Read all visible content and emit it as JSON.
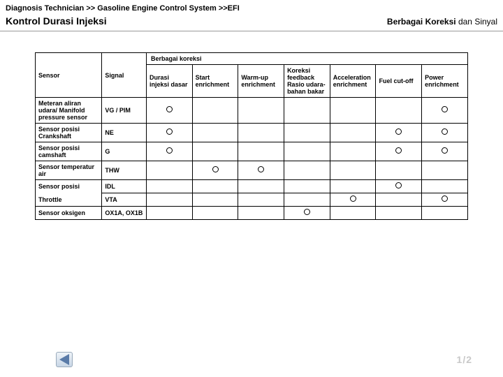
{
  "breadcrumb": "Diagnosis Technician >> Gasoline Engine Control System >>EFI",
  "title_left": "Kontrol Durasi Injeksi",
  "title_right_bold": "Berbagai Koreksi",
  "title_right_rest": " dan Sinyal",
  "table": {
    "header_sensor": "Sensor",
    "header_signal": "Signal",
    "header_group": "Berbagai koreksi",
    "cols": {
      "c0": "Durasi injeksi dasar",
      "c1": "Start enrichment",
      "c2": "Warm-up enrichment",
      "c3": "Koreksi feedback Rasio udara-bahan bakar",
      "c4": "Acceleration enrichment",
      "c5": "Fuel cut-off",
      "c6": "Power enrichment"
    },
    "rows": [
      {
        "sensor": "Meteran aliran udara/ Manifold pressure sensor",
        "signal": "VG / PIM",
        "marks": [
          1,
          0,
          0,
          0,
          0,
          0,
          1
        ]
      },
      {
        "sensor": "Sensor posisi Crankshaft",
        "signal": "NE",
        "marks": [
          1,
          0,
          0,
          0,
          0,
          1,
          1
        ]
      },
      {
        "sensor": "Sensor posisi camshaft",
        "signal": "G",
        "marks": [
          1,
          0,
          0,
          0,
          0,
          1,
          1
        ]
      },
      {
        "sensor": "Sensor temperatur air",
        "signal": "THW",
        "marks": [
          0,
          1,
          1,
          0,
          0,
          0,
          0
        ]
      },
      {
        "sensor": "Sensor posisi",
        "signal": "IDL",
        "marks": [
          0,
          0,
          0,
          0,
          0,
          1,
          0
        ],
        "split_top": true
      },
      {
        "sensor": "Throttle",
        "signal": "VTA",
        "marks": [
          0,
          0,
          0,
          0,
          1,
          0,
          1
        ],
        "split_bottom": true
      },
      {
        "sensor": "Sensor oksigen",
        "signal": "OX1A, OX1B",
        "marks": [
          0,
          0,
          0,
          1,
          0,
          0,
          0
        ]
      }
    ]
  },
  "page": "1/2"
}
